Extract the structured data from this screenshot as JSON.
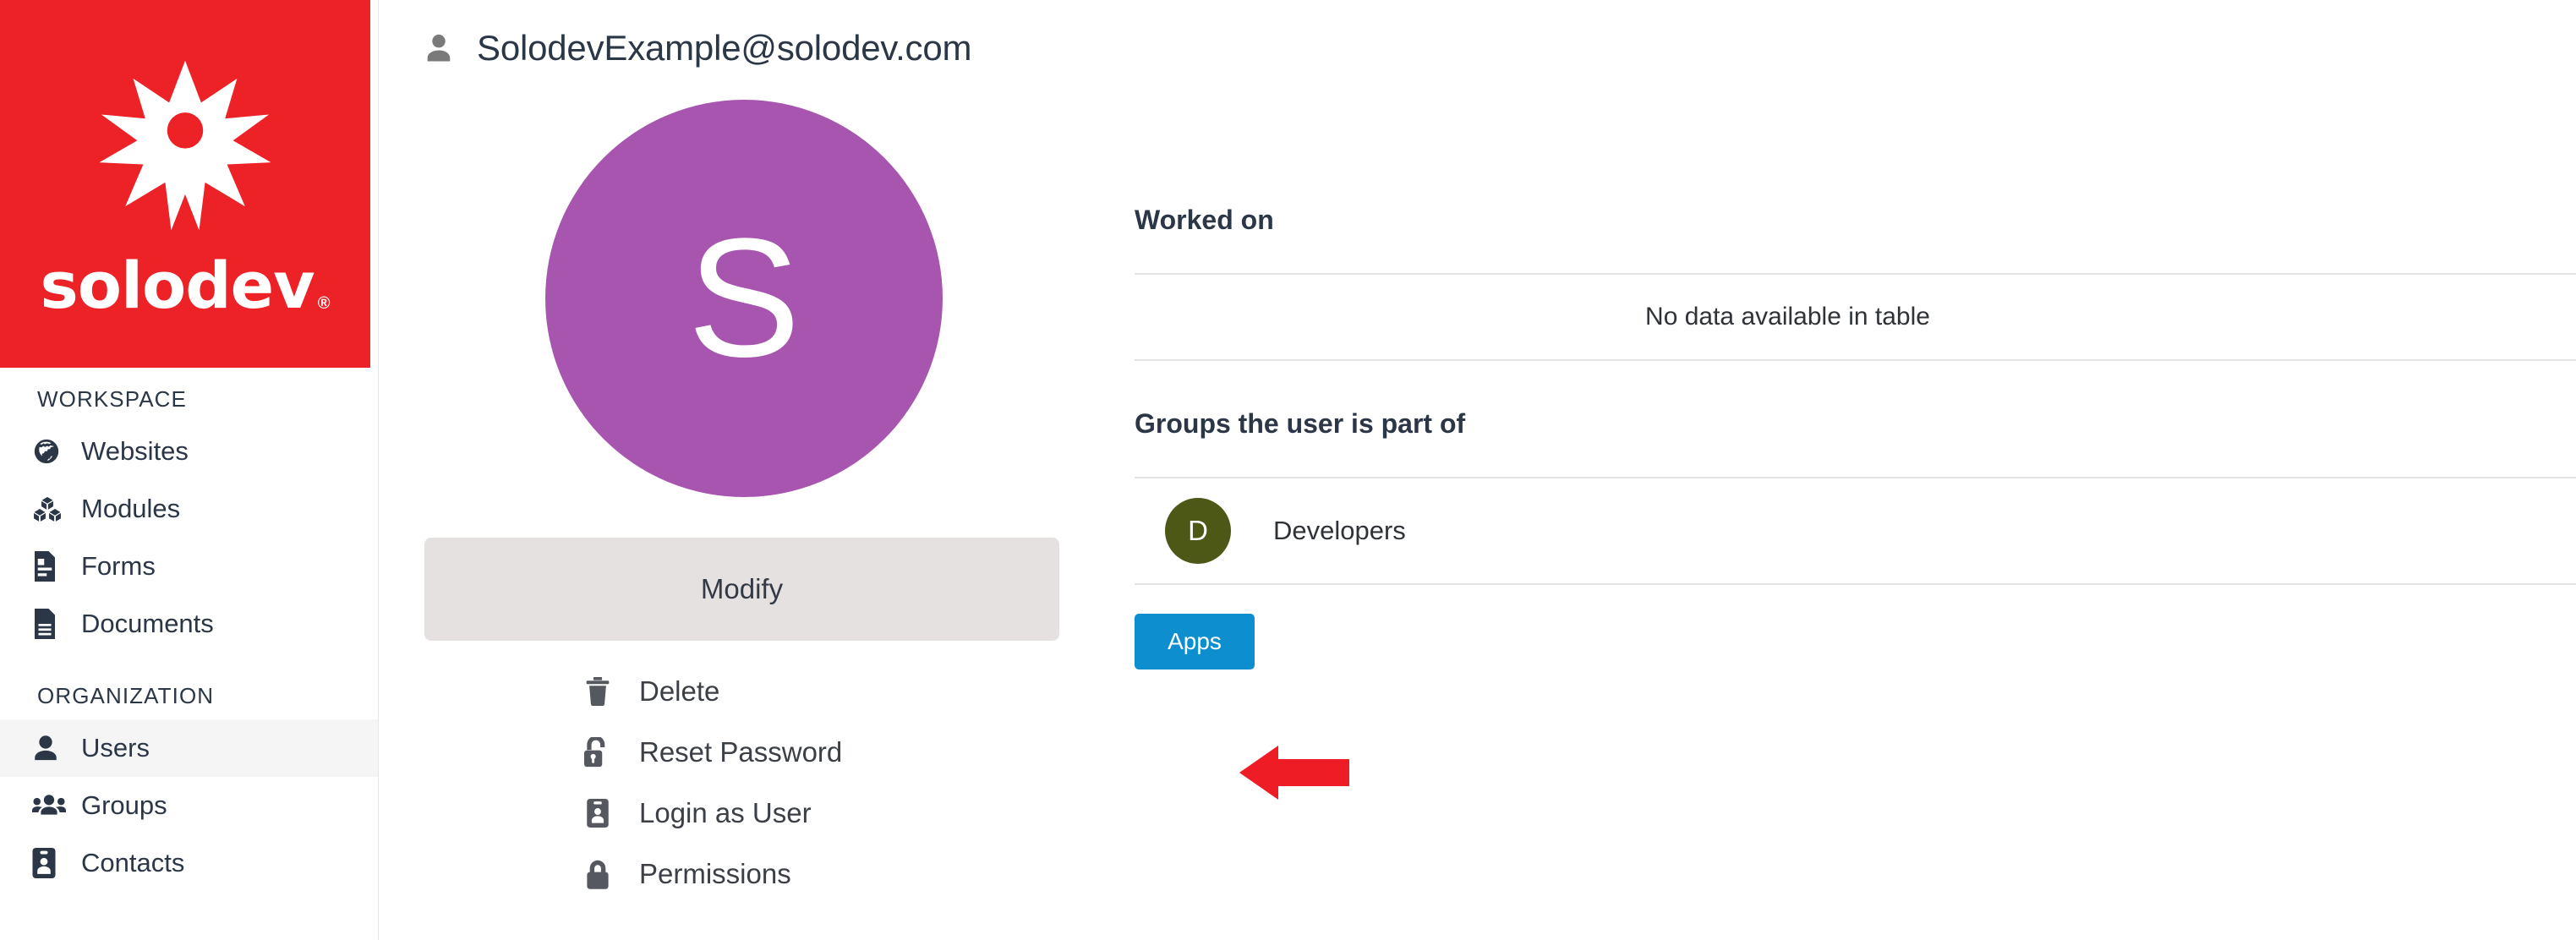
{
  "brand": {
    "name": "solodev",
    "registered_mark": "®",
    "logo_color": "#ec2227",
    "logo_icon": "solodev-star-person-logo"
  },
  "sidebar": {
    "sections": [
      {
        "heading": "WORKSPACE",
        "items": [
          {
            "label": "Websites",
            "icon": "globe-icon",
            "active": false
          },
          {
            "label": "Modules",
            "icon": "cubes-icon",
            "active": false
          },
          {
            "label": "Forms",
            "icon": "form-icon",
            "active": false
          },
          {
            "label": "Documents",
            "icon": "document-icon",
            "active": false
          }
        ]
      },
      {
        "heading": "ORGANIZATION",
        "items": [
          {
            "label": "Users",
            "icon": "user-icon",
            "active": true
          },
          {
            "label": "Groups",
            "icon": "users-group-icon",
            "active": false
          },
          {
            "label": "Contacts",
            "icon": "id-badge-icon",
            "active": false
          }
        ]
      }
    ]
  },
  "header": {
    "icon": "user-icon",
    "title": "SolodevExample@solodev.com"
  },
  "profile": {
    "avatar_initial": "S",
    "avatar_color": "#a855b0",
    "modify_label": "Modify",
    "actions": [
      {
        "label": "Delete",
        "icon": "trash-icon"
      },
      {
        "label": "Reset Password",
        "icon": "unlock-icon"
      },
      {
        "label": "Login as User",
        "icon": "id-badge-icon"
      },
      {
        "label": "Permissions",
        "icon": "lock-icon"
      }
    ]
  },
  "worked_on": {
    "title": "Worked on",
    "empty_message": "No data available in table"
  },
  "groups": {
    "title": "Groups the user is part of",
    "rows": [
      {
        "initial": "D",
        "name": "Developers",
        "color": "#4d5716"
      }
    ],
    "apps_label": "Apps"
  },
  "annotation": {
    "arrow": "left-pointing-arrow",
    "color": "#ee1c25",
    "points_at": "Reset Password"
  }
}
